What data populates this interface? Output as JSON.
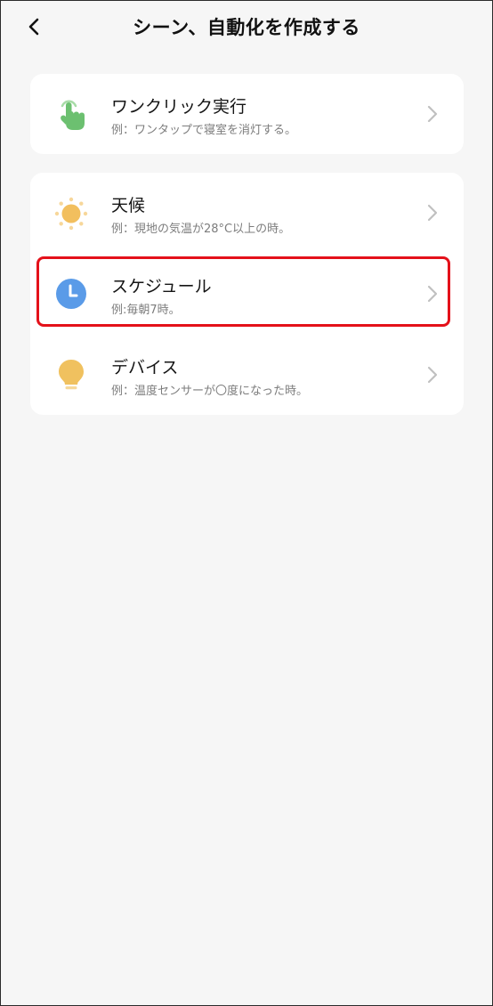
{
  "header": {
    "title": "シーン、自動化を作成する",
    "back_icon": "chevron-left-icon"
  },
  "items": [
    {
      "title": "ワンクリック実行",
      "subtitle": "例：ワンタップで寝室を消灯する。",
      "icon": "tap-hand-icon",
      "icon_color": "#6cc070"
    },
    {
      "title": "天候",
      "subtitle": "例：現地の気温が28°C以上の時。",
      "icon": "sun-icon",
      "icon_color": "#f2bf5e"
    },
    {
      "title": "スケジュール",
      "subtitle": "例:毎朝7時。",
      "icon": "clock-icon",
      "icon_color": "#5a9be8",
      "highlighted": true
    },
    {
      "title": "デバイス",
      "subtitle": "例：温度センサーが〇度になった時。",
      "icon": "lightbulb-icon",
      "icon_color": "#f0c15f"
    }
  ],
  "colors": {
    "background": "#f6f6f6",
    "card": "#ffffff",
    "highlight_border": "#e4111a",
    "chevron": "#c0c0c0"
  }
}
